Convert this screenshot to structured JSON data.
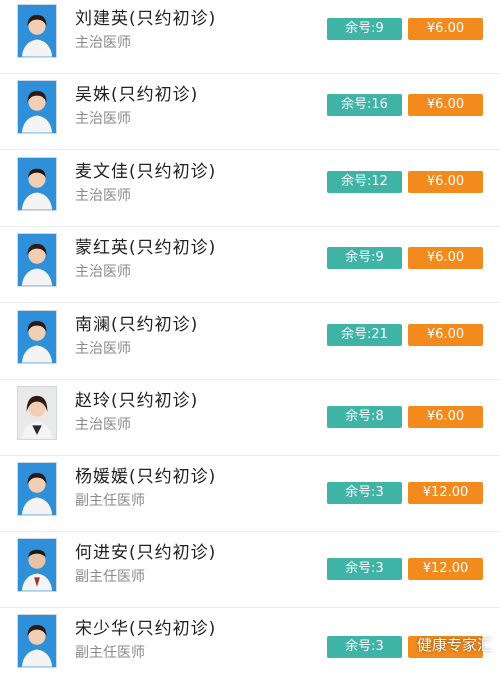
{
  "colors": {
    "remaining_bg": "#3fb3a6",
    "price_bg": "#f28a1e",
    "avatar_bg": "#2f8fd8"
  },
  "doctors": [
    {
      "name": "刘建英(只约初诊)",
      "title": "主治医师",
      "remaining": "余号:9",
      "price": "¥6.00"
    },
    {
      "name": "吴姝(只约初诊)",
      "title": "主治医师",
      "remaining": "余号:16",
      "price": "¥6.00"
    },
    {
      "name": "麦文佳(只约初诊)",
      "title": "主治医师",
      "remaining": "余号:12",
      "price": "¥6.00"
    },
    {
      "name": "蒙红英(只约初诊)",
      "title": "主治医师",
      "remaining": "余号:9",
      "price": "¥6.00"
    },
    {
      "name": "南澜(只约初诊)",
      "title": "主治医师",
      "remaining": "余号:21",
      "price": "¥6.00"
    },
    {
      "name": "赵玲(只约初诊)",
      "title": "主治医师",
      "remaining": "余号:8",
      "price": "¥6.00"
    },
    {
      "name": "杨媛媛(只约初诊)",
      "title": "副主任医师",
      "remaining": "余号:3",
      "price": "¥12.00"
    },
    {
      "name": "何进安(只约初诊)",
      "title": "副主任医师",
      "remaining": "余号:3",
      "price": "¥12.00"
    },
    {
      "name": "宋少华(只约初诊)",
      "title": "副主任医师",
      "remaining": "余号:3",
      "price": ""
    }
  ],
  "watermark": "健康专家汇"
}
